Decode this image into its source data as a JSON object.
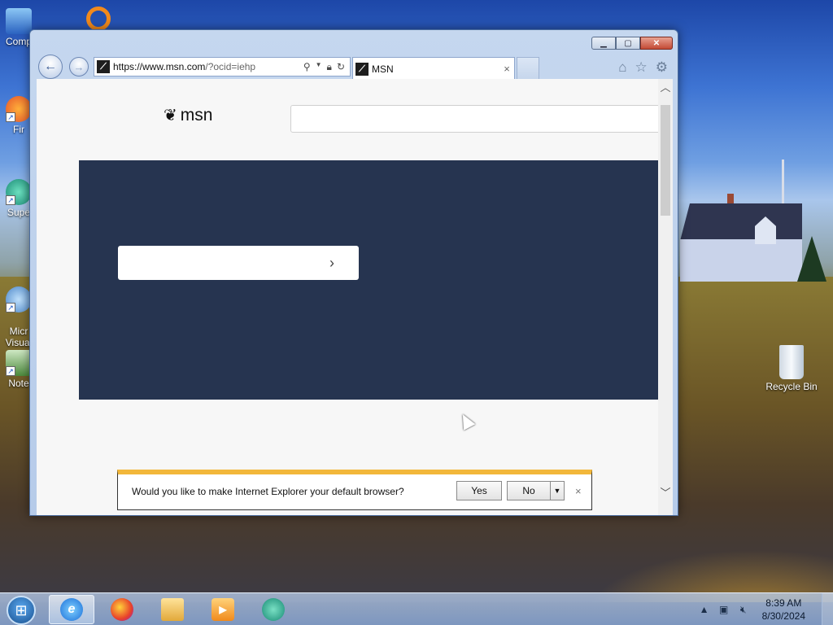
{
  "desktop": {
    "icons": [
      {
        "label": "Comp",
        "icon": "computer-icon"
      },
      {
        "label": "Fir",
        "icon": "firefox-icon"
      },
      {
        "label": "Supe",
        "icon": "app-icon"
      },
      {
        "label": "Micr\nVisual",
        "icon": "visual-studio-icon"
      },
      {
        "label": "Note",
        "icon": "notepad-icon"
      }
    ],
    "recycle_bin": "Recycle Bin"
  },
  "browser": {
    "address": {
      "scheme_host": "https://www.msn.com",
      "path": "/?ocid=iehp"
    },
    "tab": {
      "title": "MSN",
      "close": "×"
    },
    "tools": [
      "home-icon",
      "favorites-icon",
      "settings-icon"
    ]
  },
  "page": {
    "logo_text": "msn",
    "hero_button_glyph": "›"
  },
  "notification": {
    "message": "Would you like to make Internet Explorer your default browser?",
    "yes": "Yes",
    "no": "No",
    "close": "×"
  },
  "taskbar": {
    "time": "8:39 AM",
    "date": "8/30/2024",
    "pinned": [
      "internet-explorer-icon",
      "firefox-icon",
      "file-explorer-icon",
      "media-player-icon",
      "app-icon"
    ]
  },
  "colors": {
    "hero_bg": "#263450",
    "notification_accent": "#f2b73b"
  }
}
